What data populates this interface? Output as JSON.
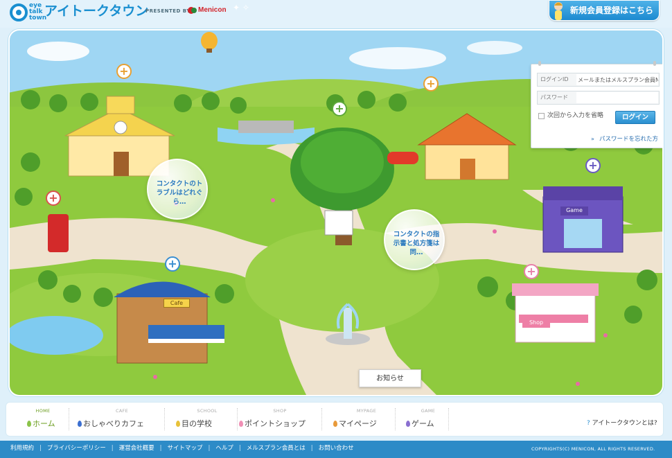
{
  "header": {
    "logo_en": "eye talk town",
    "logo_jp": "アイトークタウン",
    "presented_by": "PRESENTED BY",
    "sponsor": "Menicon",
    "register_button": "新規会員登録はこちら"
  },
  "scene": {
    "bubble_trouble": "コンタクトのトラブルはどれぐら…",
    "bubble_prescription": "コンタクトの指示書と処方箋は同…",
    "sign_cafe": "Cafe",
    "sign_game": "Game",
    "sign_shop": "Shop",
    "notice_button": "お知らせ"
  },
  "login": {
    "id_label": "ログインID",
    "id_placeholder": "メールまたはメルスプラン会員No.",
    "password_label": "パスワード",
    "remember_label": "次回から入力を省略",
    "login_button": "ログイン",
    "forgot_link": "パスワードを忘れた方"
  },
  "nav": {
    "items": [
      {
        "en": "HOME",
        "label": "ホーム",
        "color": "#8bc34a"
      },
      {
        "en": "CAFE",
        "label": "おしゃべりカフェ",
        "color": "#3b6fd0"
      },
      {
        "en": "SCHOOL",
        "label": "目の学校",
        "color": "#e8c23a"
      },
      {
        "en": "SHOP",
        "label": "ポイントショップ",
        "color": "#f08fb5"
      },
      {
        "en": "MYPAGE",
        "label": "マイページ",
        "color": "#e89a3a"
      },
      {
        "en": "GAME",
        "label": "ゲーム",
        "color": "#8a6fd0"
      }
    ],
    "about": "アイトークタウンとは?"
  },
  "footer": {
    "links": [
      "利用規約",
      "プライバシーポリシー",
      "運営会社概要",
      "サイトマップ",
      "ヘルプ",
      "メルスプラン会員とは",
      "お問い合わせ"
    ],
    "copyright": "COPYRIGHTS(C) MENICON, ALL RIGHTS RESERVED."
  }
}
